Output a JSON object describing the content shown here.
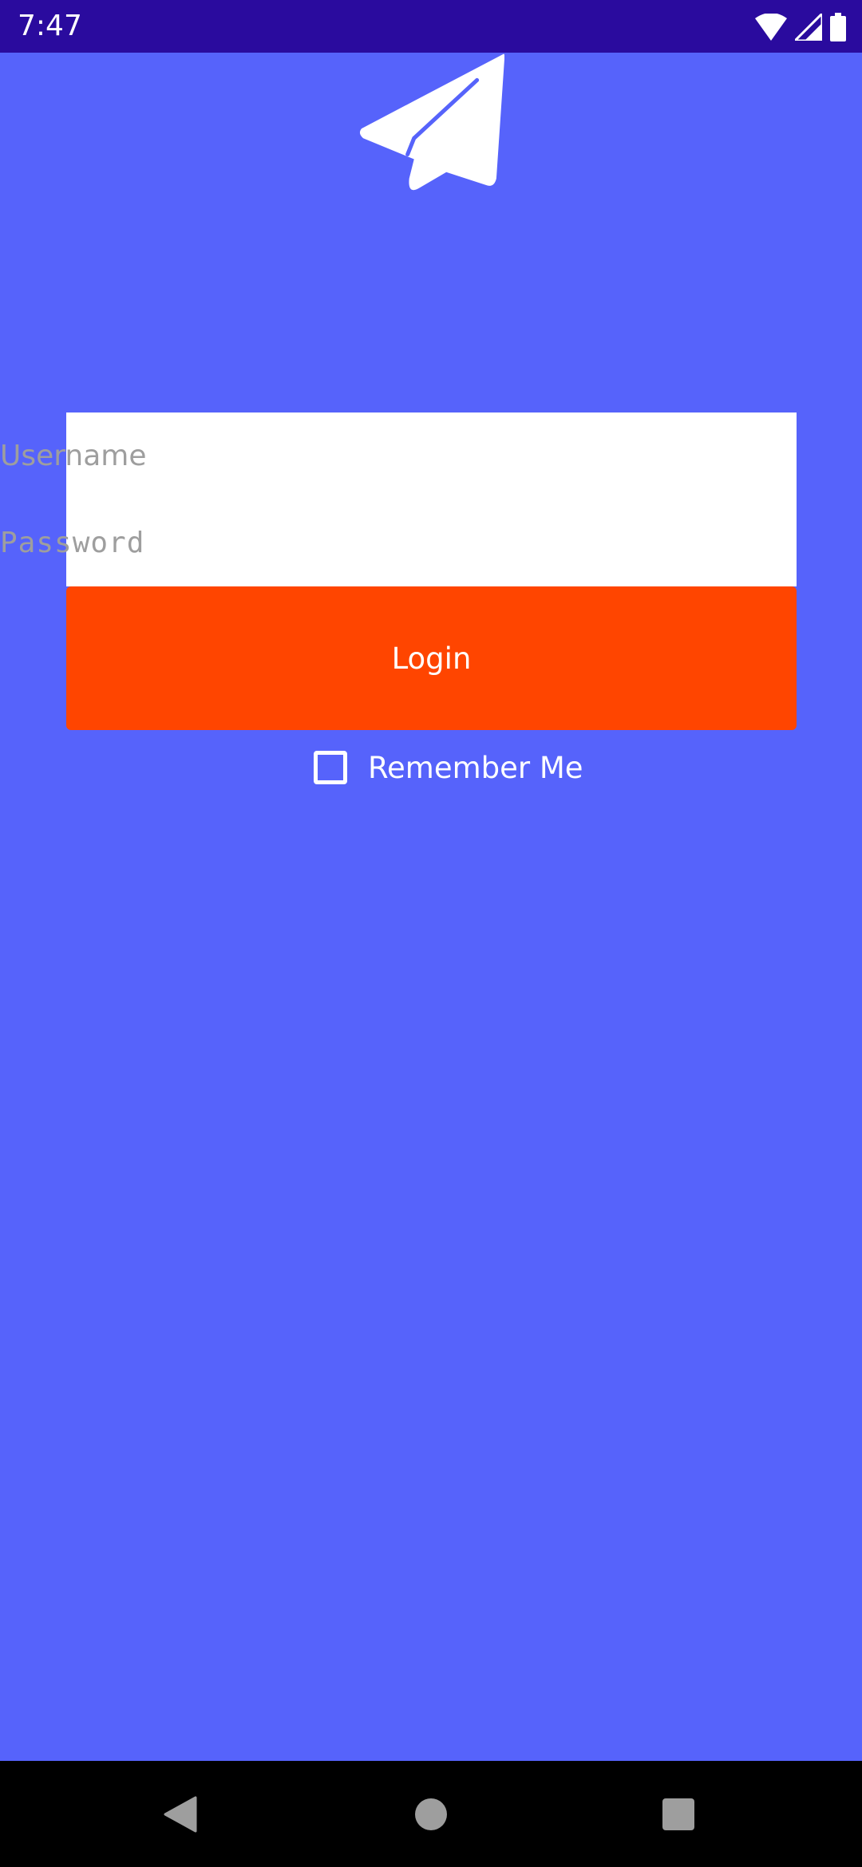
{
  "status_bar": {
    "time": "7:47",
    "icons": [
      "wifi-icon",
      "signal-icon",
      "battery-icon"
    ]
  },
  "logo": {
    "icon": "paper-plane-icon"
  },
  "form": {
    "username_placeholder": "Username",
    "password_placeholder": "Password",
    "login_label": "Login",
    "remember_label": "Remember Me",
    "remember_checked": false
  },
  "nav_bar": {
    "icons": [
      "back-icon",
      "home-icon",
      "recents-icon"
    ]
  },
  "colors": {
    "background": "#5663FB",
    "status_bar": "#2A0B9E",
    "login_button": "#FF4500",
    "input_background": "#FFFFFF",
    "placeholder_text": "#9E9E9E",
    "nav_bar": "#000000"
  }
}
